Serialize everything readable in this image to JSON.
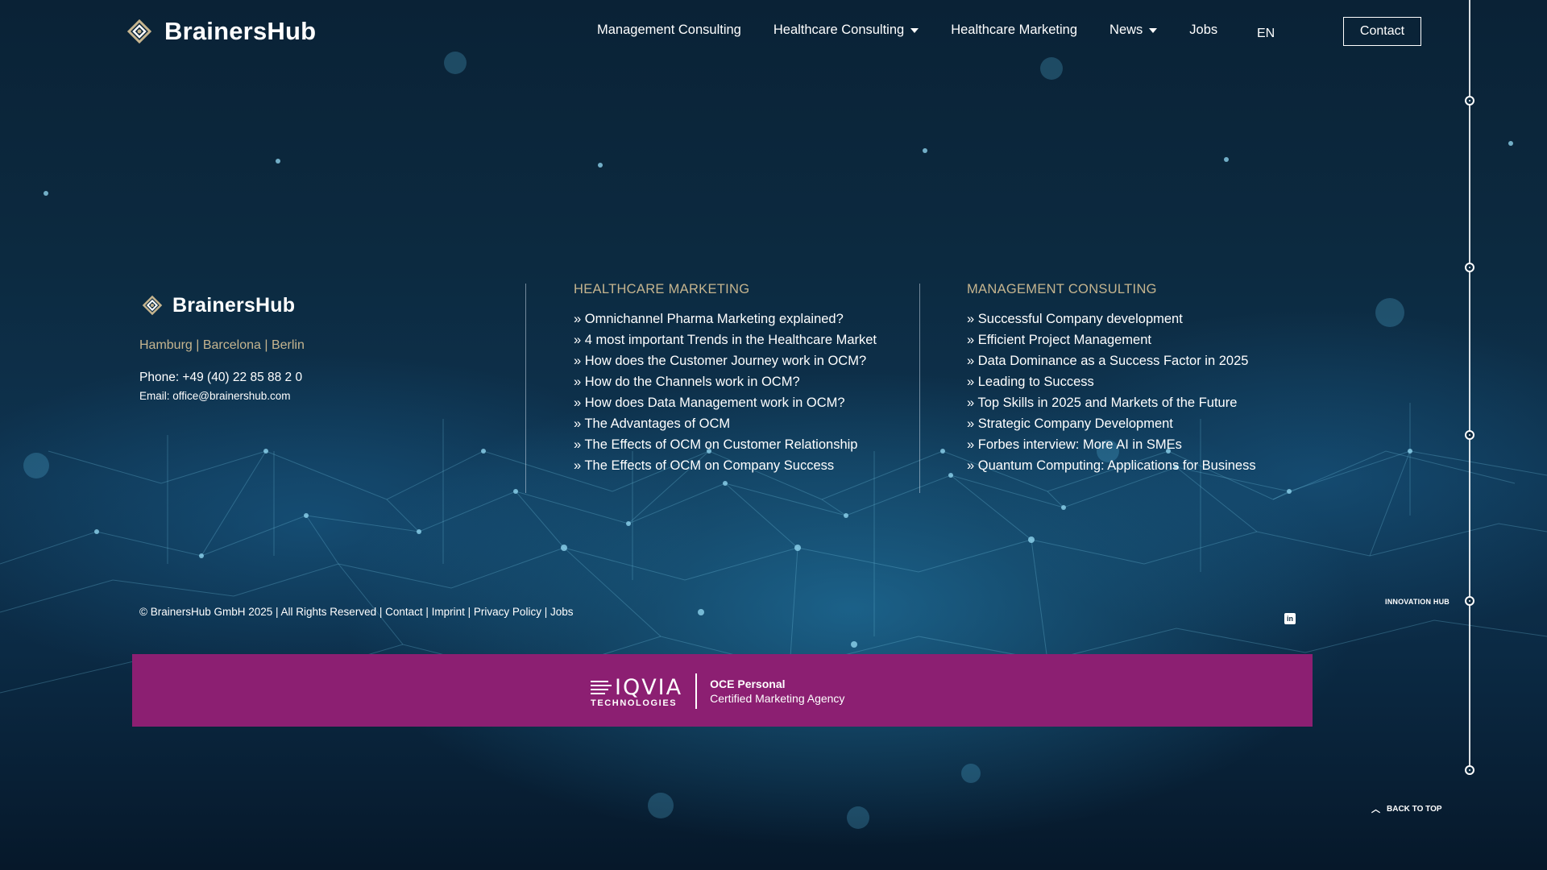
{
  "header": {
    "brand": "BrainersHub",
    "nav": [
      {
        "label": "Management Consulting",
        "dropdown": false
      },
      {
        "label": "Healthcare Consulting",
        "dropdown": true
      },
      {
        "label": "Healthcare Marketing",
        "dropdown": false
      },
      {
        "label": "News",
        "dropdown": true
      },
      {
        "label": "Jobs",
        "dropdown": false
      }
    ],
    "language": "EN",
    "contact_label": "Contact"
  },
  "footer": {
    "brand": "BrainersHub",
    "cities": "Hamburg | Barcelona | Berlin",
    "phone": "Phone: +49 (40) 22 85 88 2 0",
    "email_label": "Email: ",
    "email": "office@brainershub.com",
    "columns": [
      {
        "title": "HEALTHCARE MARKETING",
        "links": [
          "» Omnichannel Pharma Marketing explained?",
          "» 4 most important Trends in the Healthcare Market",
          "» How does the Customer Journey work in OCM?",
          "» How do the Channels work in OCM?",
          "» How does Data Management work in OCM?",
          "» The Advantages of OCM",
          "» The Effects of OCM on Customer Relationship",
          "» The Effects of OCM on Company Success"
        ]
      },
      {
        "title": "MANAGEMENT CONSULTING",
        "links": [
          "» Successful Company development",
          "» Efficient Project Management",
          "» Data Dominance as a Success Factor in 2025",
          "» Leading to Success",
          "» Top Skills in 2025 and Markets of the Future",
          "» Strategic Company Development",
          "» Forbes interview: More AI in SMEs",
          "» Quantum Computing: Applications for Business"
        ]
      }
    ],
    "copyright": {
      "text": "© BrainersHub GmbH 2025 | All Rights Reserved | ",
      "links": [
        "Contact",
        "Imprint",
        "Privacy Policy",
        "Jobs"
      ]
    }
  },
  "side": {
    "innovation_label": "INNOVATION HUB",
    "back_to_top": "BACK TO TOP"
  },
  "banner": {
    "logo_word": "IQVIA",
    "logo_sub": "TECHNOLOGIES",
    "title": "OCE Personal",
    "subtitle": "Certified Marketing Agency",
    "color": "#8c1f72"
  },
  "colors": {
    "accent_gold": "#c6b58f",
    "background": "#0c2a40"
  }
}
